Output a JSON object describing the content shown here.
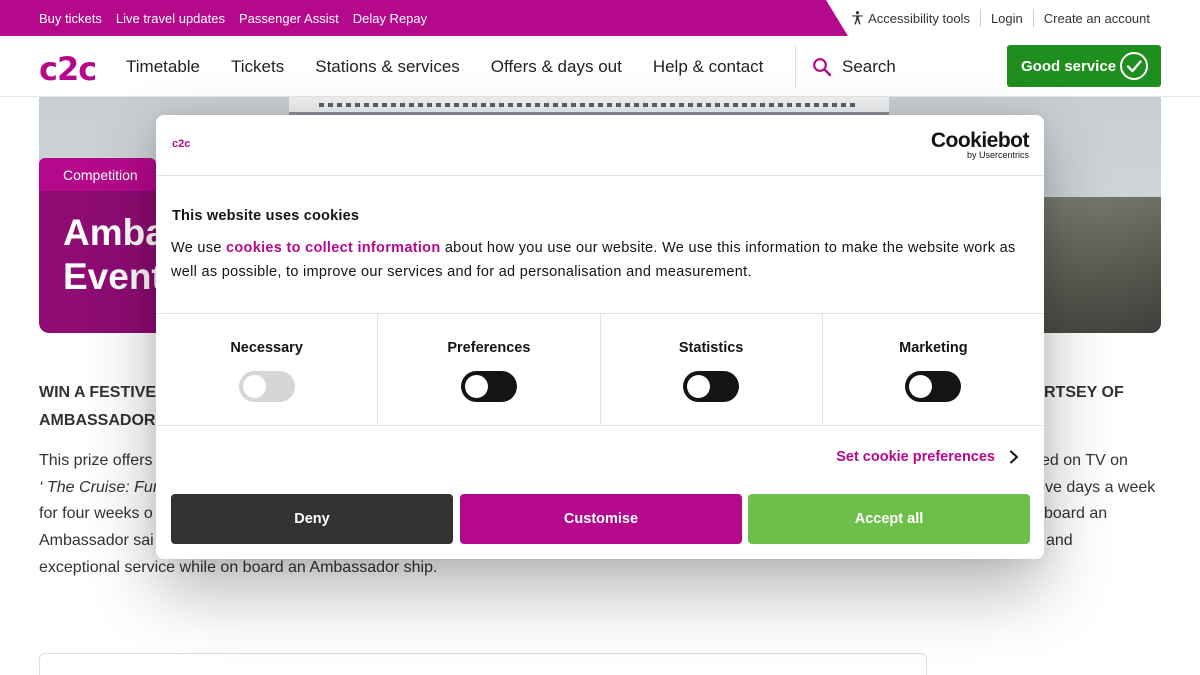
{
  "topbar": {
    "links": [
      "Buy tickets",
      "Live travel updates",
      "Passenger Assist",
      "Delay Repay"
    ],
    "right": {
      "accessibility": "Accessibility tools",
      "login": "Login",
      "create_account": "Create an account"
    }
  },
  "nav": {
    "logo": "c2c",
    "links": [
      "Timetable",
      "Tickets",
      "Stations & services",
      "Offers & days out",
      "Help & contact"
    ],
    "search_label": "Search",
    "status": "Good service"
  },
  "hero": {
    "tag": "Competition",
    "title_line1": "Ambassador",
    "title_line2": "Event"
  },
  "article": {
    "heading_left_line1": "WIN A FESTIVE",
    "heading_left_line2": "AMBASSADOR",
    "heading_right": "RTSEY OF",
    "left_lines": [
      "This prize offers",
      "‘ The Cruise: Fun",
      "for four weeks o",
      "Ambassador sai",
      "exceptional service while on board an Ambassador ship."
    ],
    "right_lines": [
      "ed on TV on",
      "ve days a week",
      "board an",
      "and"
    ]
  },
  "cookie": {
    "brand": "c2c",
    "provider_name": "Cookiebot",
    "provider_by": "by Usercentrics",
    "heading": "This website uses cookies",
    "text_before": "We use ",
    "text_link": "cookies to collect information",
    "text_after": " about how you use our website. We use this information to make the website work as well as possible, to improve our services and for ad personalisation and measurement.",
    "categories": [
      {
        "label": "Necessary",
        "enabled": false,
        "disabled": true
      },
      {
        "label": "Preferences",
        "enabled": false,
        "disabled": false
      },
      {
        "label": "Statistics",
        "enabled": false,
        "disabled": false
      },
      {
        "label": "Marketing",
        "enabled": false,
        "disabled": false
      }
    ],
    "set_prefs": "Set cookie preferences",
    "buttons": {
      "deny": "Deny",
      "customise": "Customise",
      "accept": "Accept all"
    }
  },
  "colors": {
    "brand": "#b5098c",
    "brand_dark": "#8e0c74",
    "good_service": "#1e8e1e",
    "accept": "#6cc04a",
    "deny": "#333333"
  }
}
